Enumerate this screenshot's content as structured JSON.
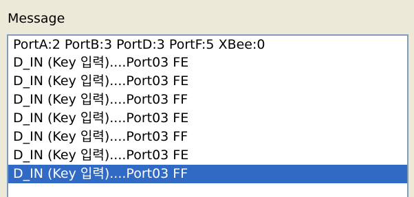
{
  "group": {
    "title": "Message"
  },
  "messages": {
    "selected_index": 7,
    "items": [
      "PortA:2 PortB:3 PortD:3 PortF:5 XBee:0",
      "D_IN (Key 입력)....Port03  FE",
      "D_IN (Key 입력)....Port03  FE",
      "D_IN (Key 입력)....Port03  FF",
      "D_IN (Key 입력)....Port03  FE",
      "D_IN (Key 입력)....Port03  FF",
      "D_IN (Key 입력)....Port03  FE",
      "D_IN (Key 입력)....Port03  FF"
    ]
  },
  "colors": {
    "window_background": "#ece9d8",
    "list_background": "#ffffff",
    "list_border": "#7f9db9",
    "selection_background": "#316ac5",
    "selection_text": "#ffffff"
  }
}
